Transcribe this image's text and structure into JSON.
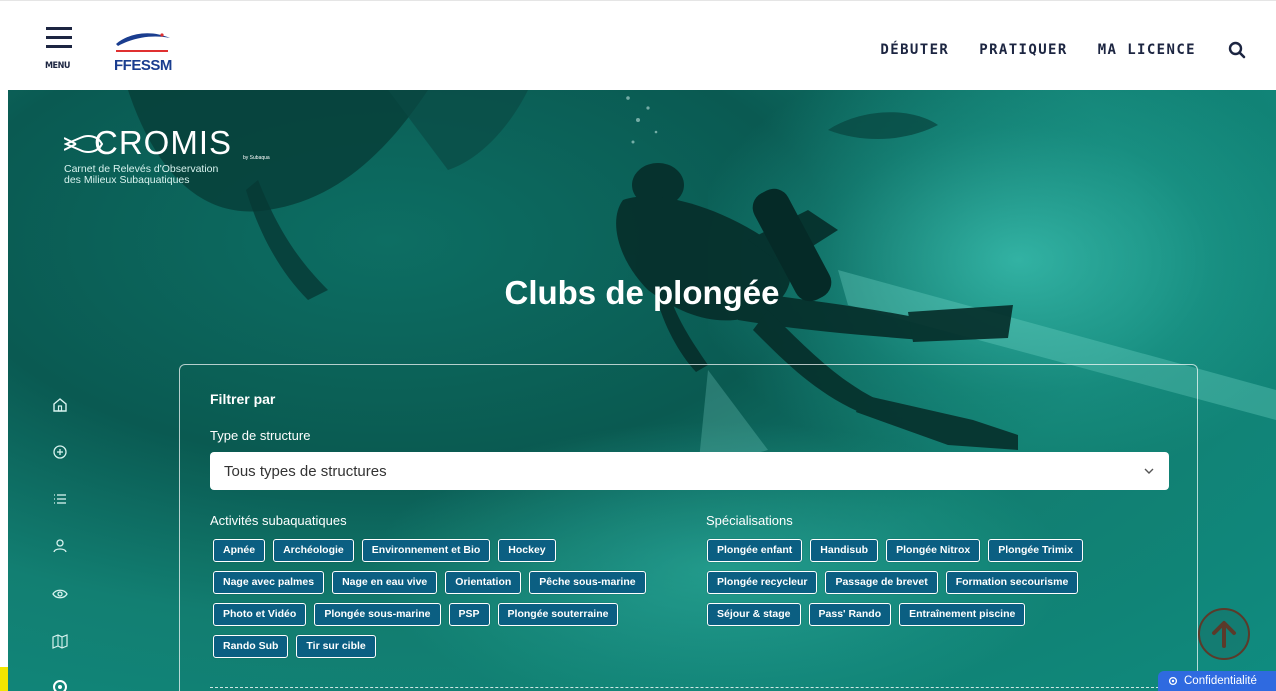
{
  "header": {
    "menu_label": "MENU",
    "logo_text": "FFESSM",
    "nav": [
      "DÉBUTER",
      "PRATIQUER",
      "MA LICENCE"
    ],
    "search_icon": "search-icon"
  },
  "hero": {
    "brand_title": "CROMIS",
    "brand_by": "by Subaqua",
    "brand_subtitle_line1": "Carnet de Relevés d'Observation",
    "brand_subtitle_line2": "des Milieux Subaquatiques",
    "title": "Clubs de plongée"
  },
  "sidebar": {
    "icons": [
      "home-icon",
      "add-circle-icon",
      "list-icon",
      "user-icon",
      "eye-icon",
      "map-icon",
      "target-icon"
    ]
  },
  "filter": {
    "title": "Filtrer par",
    "type_label": "Type de structure",
    "type_value": "Tous types de structures",
    "activities_label": "Activités subaquatiques",
    "activities": [
      "Apnée",
      "Archéologie",
      "Environnement et Bio",
      "Hockey",
      "Nage avec palmes",
      "Nage en eau vive",
      "Orientation",
      "Pêche sous-marine",
      "Photo et Vidéo",
      "Plongée sous-marine",
      "PSP",
      "Plongée souterraine",
      "Rando Sub",
      "Tir sur cible"
    ],
    "specialisations_label": "Spécialisations",
    "specialisations": [
      "Plongée enfant",
      "Handisub",
      "Plongée Nitrox",
      "Plongée Trimix",
      "Plongée recycleur",
      "Passage de brevet",
      "Formation secourisme",
      "Séjour & stage",
      "Pass' Rando",
      "Entraînement piscine"
    ]
  },
  "privacy": {
    "label": "Confidentialité"
  },
  "colors": {
    "accent": "#1a3d8f",
    "chip_bg": "#0b5f82",
    "hero": "#127f72",
    "privacy": "#2f6ae0"
  }
}
